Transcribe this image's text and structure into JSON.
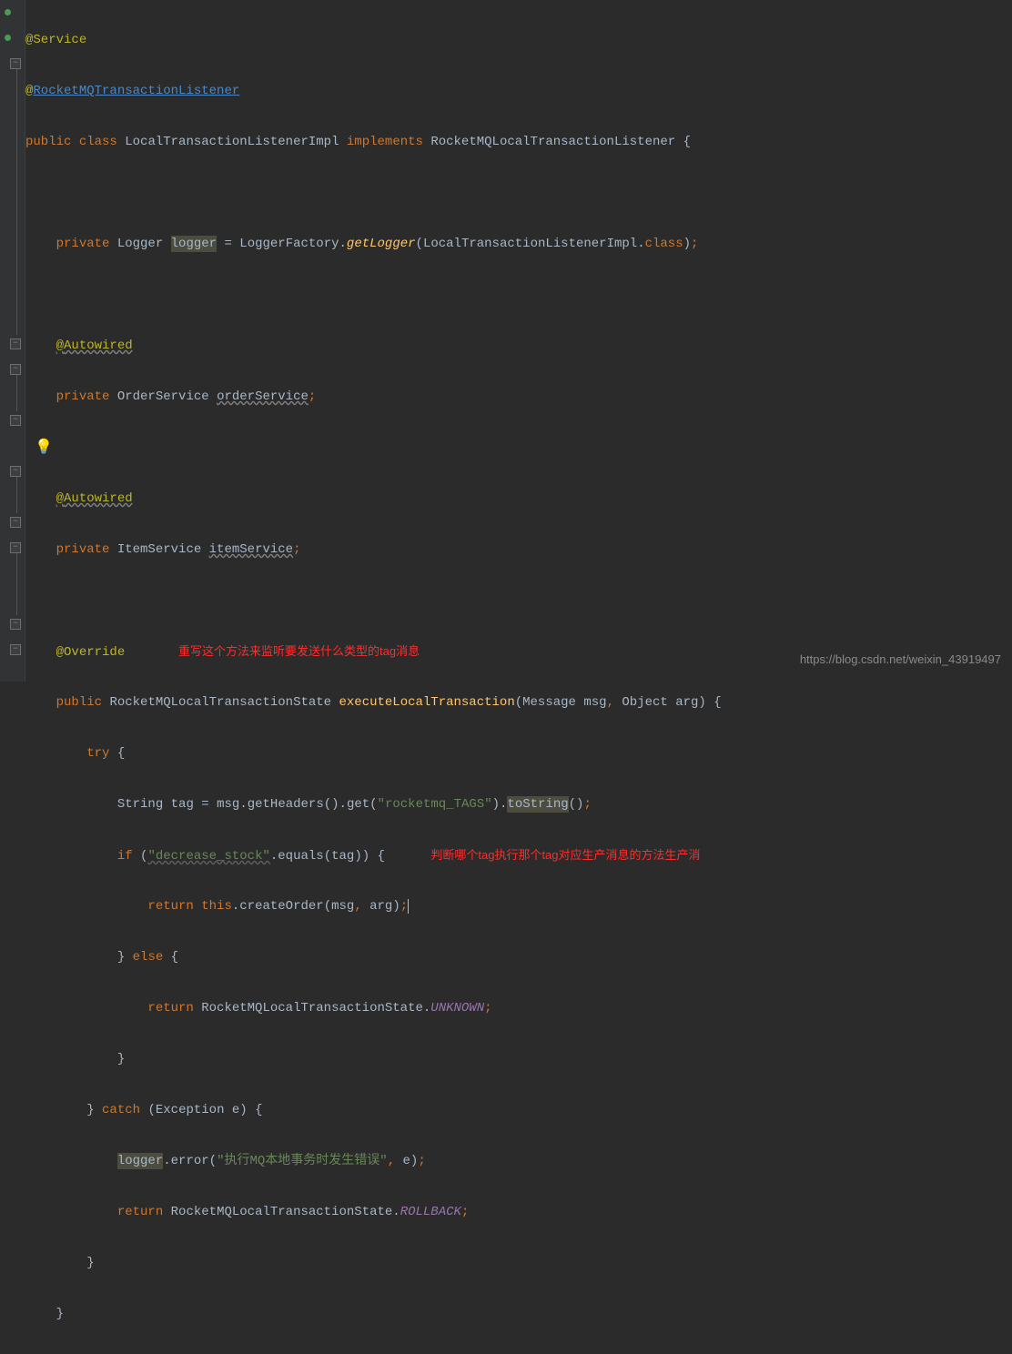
{
  "code": {
    "l1": {
      "at": "@",
      "service": "Service"
    },
    "l2": {
      "at": "@",
      "listener": "RocketMQTransactionListener"
    },
    "l3": {
      "public": "public",
      "class": "class",
      "name": "LocalTransactionListenerImpl",
      "implements": "implements",
      "iface": "RocketMQLocalTransactionListener",
      "brace": "{"
    },
    "l5": {
      "private": "private",
      "type": "Logger",
      "field": "logger",
      "eq": " = ",
      "factory": "LoggerFactory.",
      "getlogger": "getLogger",
      "lparen": "(",
      "arg": "LocalTransactionListenerImpl.",
      "classkw": "class",
      "rparen": ")",
      "semi": ";"
    },
    "l7": {
      "at": "@",
      "autowired": "Autowired"
    },
    "l8": {
      "private": "private",
      "type": "OrderService",
      "field": "orderService",
      "semi": ";"
    },
    "l10": {
      "at": "@",
      "autowired": "Autowired"
    },
    "l11": {
      "private": "private",
      "type": "ItemService",
      "field": "itemService",
      "semi": ";"
    },
    "l13": {
      "at": "@",
      "override": "Override"
    },
    "comment1": "重写这个方法来监听要发送什么类型的tag消息",
    "l14": {
      "public": "public",
      "ret": "RocketMQLocalTransactionState",
      "method": "executeLocalTransaction",
      "lparen": "(",
      "p1t": "Message",
      "p1": "msg",
      "comma": ",",
      "p2t": "Object",
      "p2": "arg",
      "rparen": ")",
      "brace": "{"
    },
    "l15": {
      "try": "try",
      "brace": "{"
    },
    "l16": {
      "type": "String",
      "var": "tag",
      "eq1": " = ",
      "msg": "msg",
      "dot1": ".",
      "geth": "getHeaders",
      "p1": "()",
      "dot2": ".",
      "get": "get",
      "lp": "(",
      "str": "\"rocketmq_TAGS\"",
      "rp": ")",
      "dot3": ".",
      "tostr": "toString",
      "p2": "()",
      "semi": ";"
    },
    "l17": {
      "if": "if",
      "lp": "(",
      "str": "\"decrease_stock\"",
      "dot": ".",
      "equals": "equals",
      "lp2": "(",
      "tag": "tag",
      "rp2": ")",
      "rp": ")",
      "brace": "{"
    },
    "comment2": "判断哪个tag执行那个tag对应生产消息的方法生产消",
    "l18": {
      "return": "return",
      "this": "this",
      "dot": ".",
      "create": "createOrder",
      "lp": "(",
      "msg": "msg",
      "comma": ",",
      "arg": "arg",
      "rp": ")",
      "semi": ";"
    },
    "l19": {
      "brace": "}",
      "else": "else",
      "brace2": "{"
    },
    "l20": {
      "return": "return",
      "state": "RocketMQLocalTransactionState.",
      "unknown": "UNKNOWN",
      "semi": ";"
    },
    "l21": {
      "brace": "}"
    },
    "l22": {
      "brace": "}",
      "catch": "catch",
      "lp": "(",
      "exc": "Exception",
      "e": "e",
      "rp": ")",
      "brace2": "{"
    },
    "l23": {
      "logger": "logger",
      "dot": ".",
      "error": "error",
      "lp": "(",
      "str": "\"执行MQ本地事务时发生错误\"",
      "comma": ",",
      "e": "e",
      "rp": ")",
      "semi": ";"
    },
    "l24": {
      "return": "return",
      "state": "RocketMQLocalTransactionState.",
      "rollback": "ROLLBACK",
      "semi": ";"
    },
    "l25": {
      "brace": "}"
    },
    "l26": {
      "brace": "}"
    }
  },
  "watermark": "https://blog.csdn.net/weixin_43919497"
}
